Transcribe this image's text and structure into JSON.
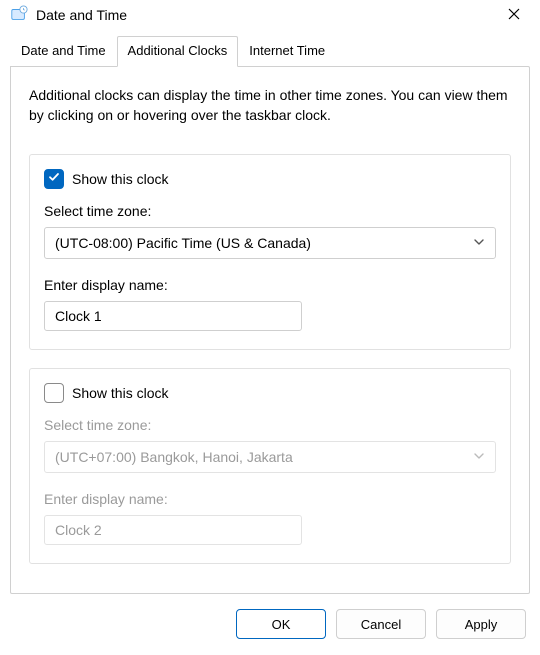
{
  "window": {
    "title": "Date and Time"
  },
  "tabs": {
    "t0": "Date and Time",
    "t1": "Additional Clocks",
    "t2": "Internet Time",
    "active_index": 1
  },
  "panel": {
    "description": "Additional clocks can display the time in other time zones. You can view them by clicking on or hovering over the taskbar clock."
  },
  "clock1": {
    "show_label": "Show this clock",
    "checked": true,
    "tz_label": "Select time zone:",
    "tz_value": "(UTC-08:00) Pacific Time (US & Canada)",
    "name_label": "Enter display name:",
    "name_value": "Clock 1"
  },
  "clock2": {
    "show_label": "Show this clock",
    "checked": false,
    "tz_label": "Select time zone:",
    "tz_value": "(UTC+07:00) Bangkok, Hanoi, Jakarta",
    "name_label": "Enter display name:",
    "name_value": "Clock 2"
  },
  "buttons": {
    "ok": "OK",
    "cancel": "Cancel",
    "apply": "Apply"
  }
}
